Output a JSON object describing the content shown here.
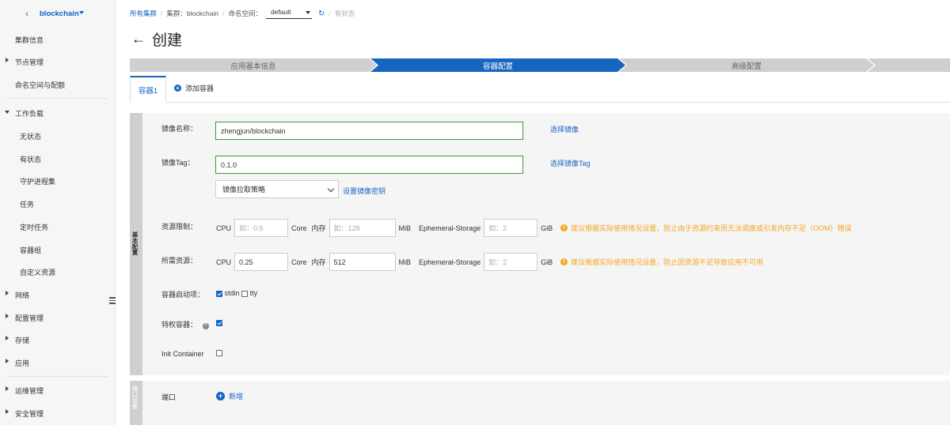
{
  "sidebar": {
    "cluster_name": "blockchain",
    "items": [
      {
        "label": "集群信息"
      },
      {
        "label": "节点管理"
      },
      {
        "label": "命名空间与配额"
      },
      {
        "label": "工作负载"
      },
      {
        "label": "无状态"
      },
      {
        "label": "有状态"
      },
      {
        "label": "守护进程集"
      },
      {
        "label": "任务"
      },
      {
        "label": "定时任务"
      },
      {
        "label": "容器组"
      },
      {
        "label": "自定义资源"
      },
      {
        "label": "网络"
      },
      {
        "label": "配置管理"
      },
      {
        "label": "存储"
      },
      {
        "label": "应用"
      },
      {
        "label": "运维管理"
      },
      {
        "label": "安全管理"
      }
    ]
  },
  "breadcrumb": {
    "all_clusters": "所有集群",
    "cluster": "集群：blockchain",
    "namespace_label": "命名空间：",
    "namespace_value": "default",
    "kind": "有状态"
  },
  "page": {
    "title": "创建"
  },
  "steps": [
    {
      "label": "应用基本信息"
    },
    {
      "label": "容器配置"
    },
    {
      "label": "高级配置"
    }
  ],
  "tabs": {
    "active": "容器1",
    "add": "添加容器"
  },
  "basic": {
    "section_label": "基本配置",
    "image_name_label": "镜像名称：",
    "image_name_value": "zhengjun/blockchain",
    "choose_image": "选择镜像",
    "image_tag_label": "镜像Tag：",
    "image_tag_value": "0.1.0",
    "choose_tag": "选择镜像Tag",
    "pull_policy": "镜像拉取策略",
    "set_secret": "设置镜像密钥",
    "limits_label": "资源限制：",
    "requests_label": "所需资源：",
    "cpu": "CPU",
    "core": "Core",
    "memory": "内存",
    "mib": "MiB",
    "ephemeral": "Ephemeral-Storage",
    "gib": "GiB",
    "limit_cpu_ph": "如：0.5",
    "limit_mem_ph": "如：128",
    "limit_eph_ph": "如：2",
    "limit_warn": "建议根据实际使用情况设置，防止由于资源约束而无法调度或引发内存不足（OOM）错误",
    "req_cpu_value": "0.25",
    "req_mem_value": "512",
    "req_eph_ph": "如：2",
    "req_warn": "建议根据实际使用情况设置，防止因资源不足导致应用不可用",
    "startup_label": "容器启动项：",
    "stdin": "stdin",
    "tty": "tty",
    "privileged_label": "特权容器：",
    "init_label": "Init Container"
  },
  "port": {
    "section_label": "端口设置",
    "label": "端口",
    "add": "新增"
  }
}
